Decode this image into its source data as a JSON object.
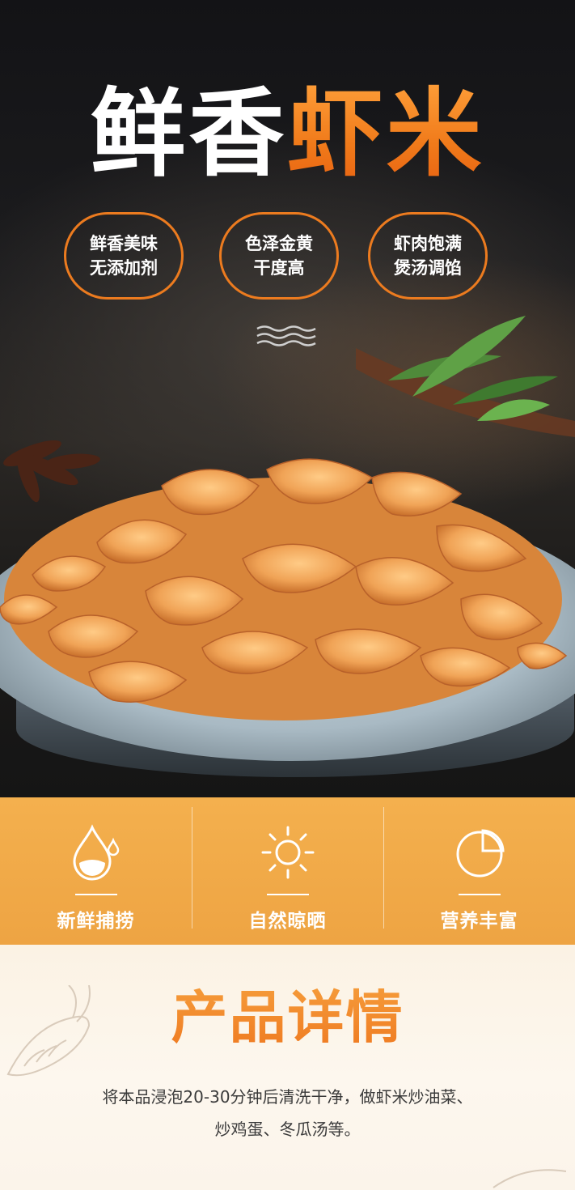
{
  "hero": {
    "title_white": "鲜香",
    "title_orange": "虾米",
    "badges": [
      {
        "line1": "鲜香美味",
        "line2": "无添加剂"
      },
      {
        "line1": "色泽金黄",
        "line2": "干度高"
      },
      {
        "line1": "虾肉饱满",
        "line2": "煲汤调馅"
      }
    ]
  },
  "features": [
    {
      "icon": "water-drop-icon",
      "label": "新鲜捕捞"
    },
    {
      "icon": "sun-icon",
      "label": "自然晾晒"
    },
    {
      "icon": "pie-chart-icon",
      "label": "营养丰富"
    }
  ],
  "details": {
    "title": "产品详情",
    "line1": "将本品浸泡20-30分钟后清洗干净，做虾米炒油菜、",
    "line2": "炒鸡蛋、冬瓜汤等。"
  },
  "colors": {
    "accent_orange": "#ef7b22",
    "band_orange": "#f4b04e",
    "dark_bg": "#1a1918"
  }
}
